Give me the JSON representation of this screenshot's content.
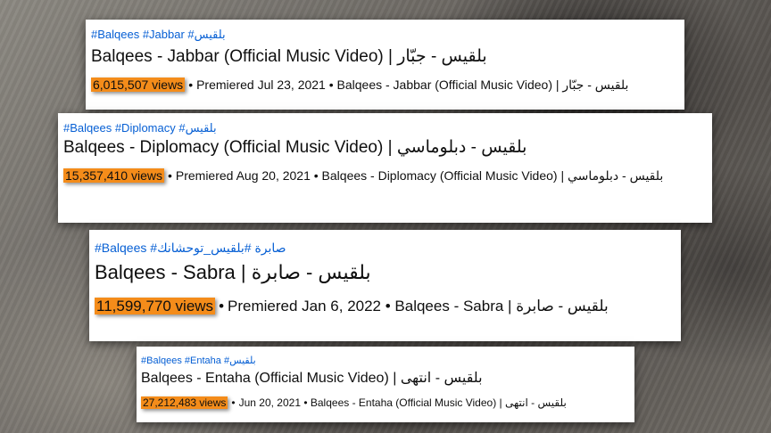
{
  "cards": [
    {
      "tags": "#Balqees #Jabbar #بلقيس",
      "title": "Balqees - Jabbar (Official Music Video) | بلقيس - جبّار",
      "views": "6,015,507 views",
      "separator": "•",
      "details": "Premiered Jul 23, 2021 • Balqees - Jabbar (Official Music Video) | بلقيس - جبّار"
    },
    {
      "tags": "#Balqees #Diplomacy #بلقيس",
      "title": "Balqees - Diplomacy (Official Music Video) | بلقيس - دبلوماسي",
      "views": "15,357,410 views",
      "separator": "•",
      "details": "Premiered Aug 20, 2021 • Balqees - Diplomacy (Official Music Video) | بلقيس - دبلوماسي"
    },
    {
      "tags": "#Balqees #صابرة #بلقيس_توحشانك",
      "title": "Balqees - Sabra | بلقيس - صابرة",
      "views": "11,599,770 views",
      "separator": "•",
      "details": "Premiered Jan 6, 2022 • Balqees - Sabra | بلقيس - صابرة"
    },
    {
      "tags": "#Balqees #Entaha #بلقيس",
      "title": "Balqees - Entaha (Official Music Video) | بلقيس - انتهى",
      "views": "27,212,483 views",
      "separator": "•",
      "details": "Jun 20, 2021 • Balqees - Entaha (Official Music Video) | بلقيس - انتهى"
    }
  ],
  "colors": {
    "tag_link": "#065fd4",
    "views_highlight": "#f48c1a",
    "card_bg": "#ffffff"
  }
}
